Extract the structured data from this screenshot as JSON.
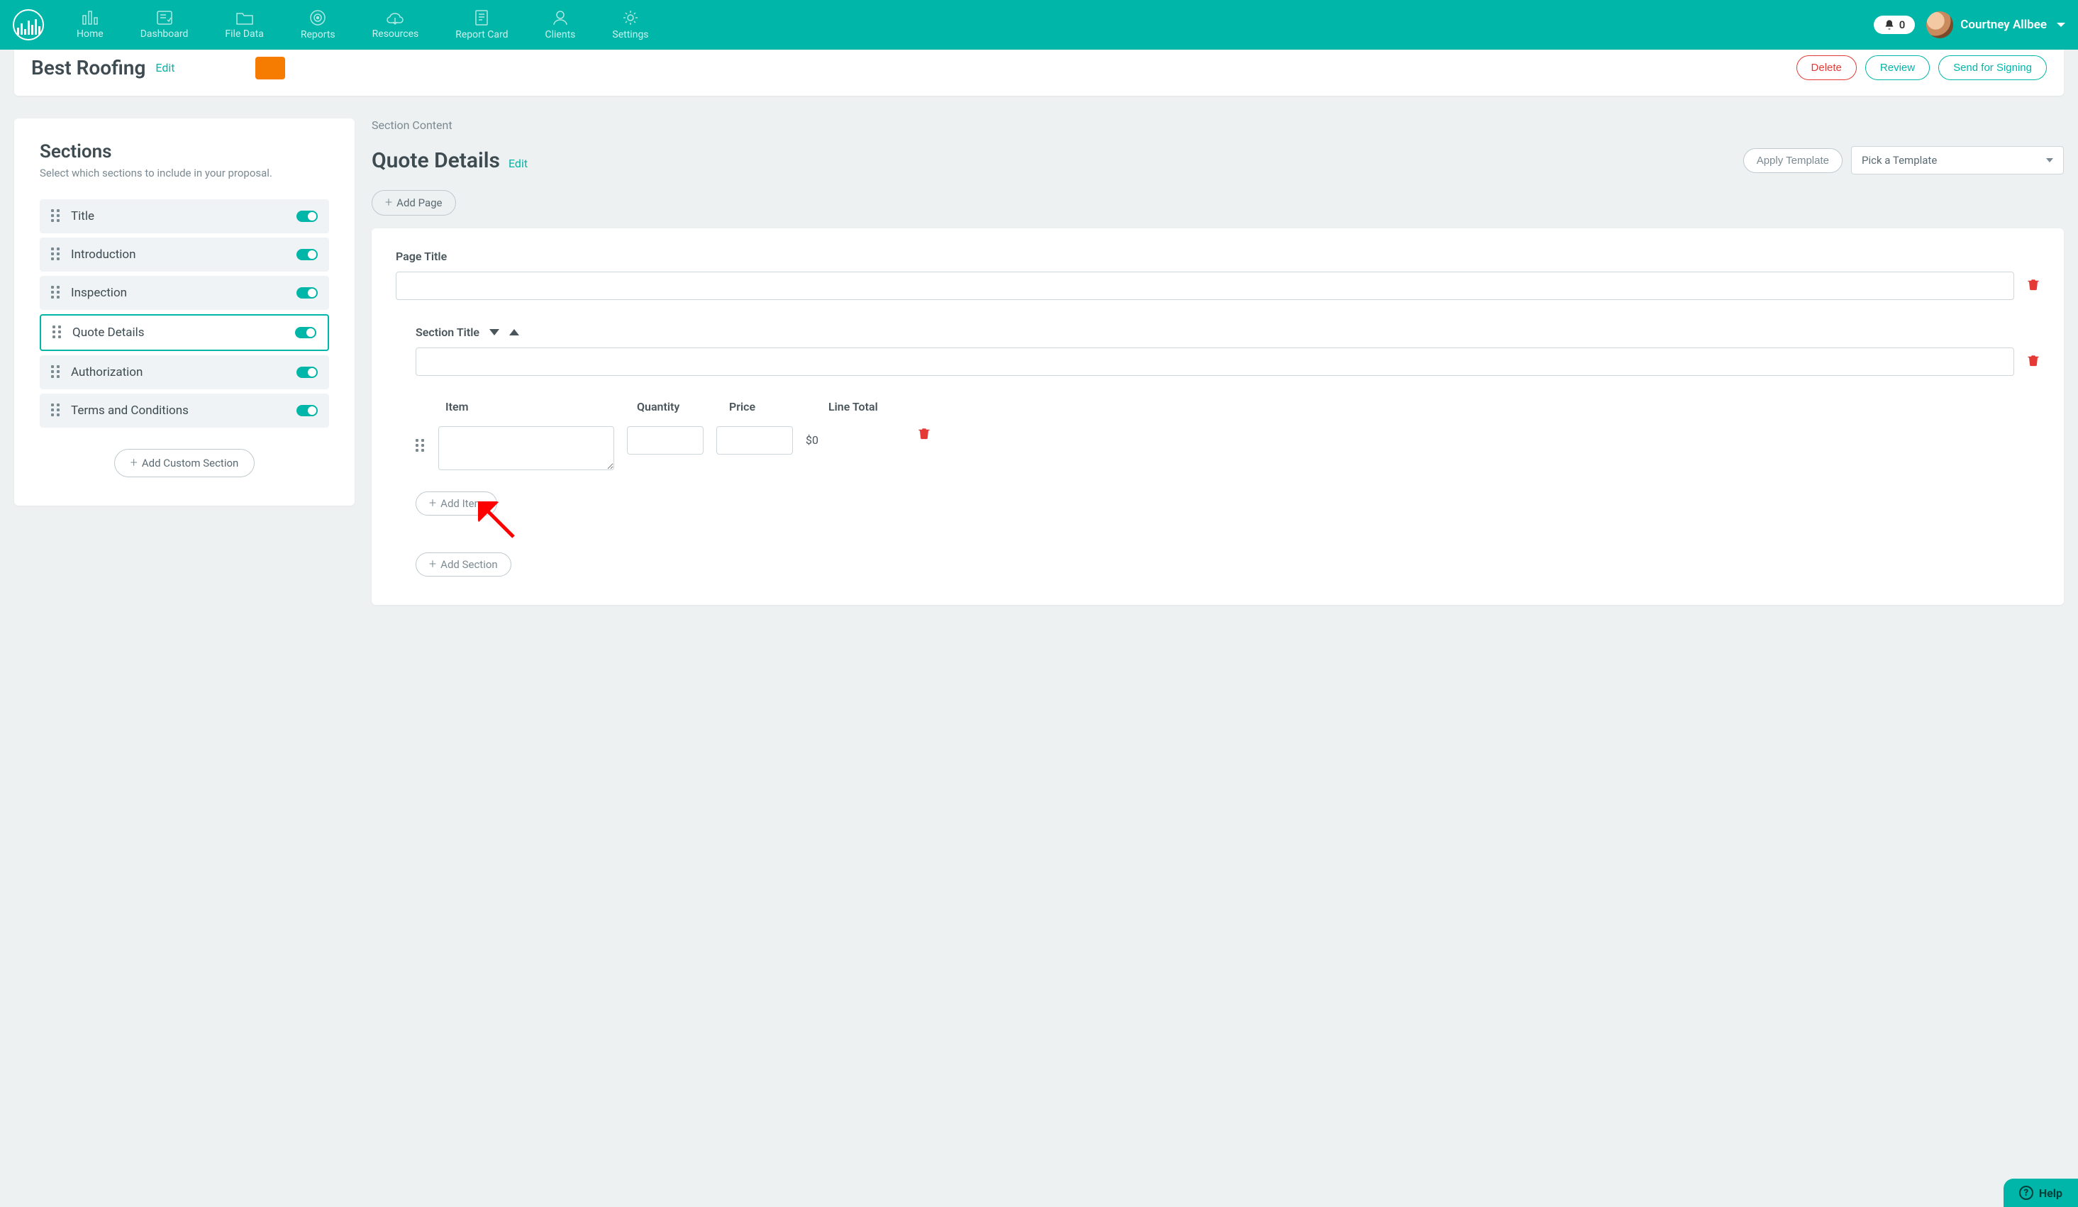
{
  "nav": {
    "items": [
      "Home",
      "Dashboard",
      "File Data",
      "Reports",
      "Resources",
      "Report Card",
      "Clients",
      "Settings"
    ],
    "notifications": "0",
    "user_name": "Courtney Allbee"
  },
  "header": {
    "title": "Best Roofing",
    "edit": "Edit",
    "actions": {
      "delete": "Delete",
      "review": "Review",
      "send": "Send for Signing"
    }
  },
  "sections_panel": {
    "heading": "Sections",
    "sub": "Select which sections to include in your proposal.",
    "items": [
      {
        "label": "Title",
        "active": false
      },
      {
        "label": "Introduction",
        "active": false
      },
      {
        "label": "Inspection",
        "active": false
      },
      {
        "label": "Quote Details",
        "active": true
      },
      {
        "label": "Authorization",
        "active": false
      },
      {
        "label": "Terms and Conditions",
        "active": false
      }
    ],
    "add_custom": "Add Custom Section"
  },
  "content": {
    "section_content_label": "Section Content",
    "title": "Quote Details",
    "edit": "Edit",
    "apply_template": "Apply Template",
    "template_placeholder": "Pick a Template",
    "add_page": "Add Page",
    "page_title_label": "Page Title",
    "page_title_value": "",
    "section_title_label": "Section Title",
    "section_title_value": "",
    "columns": {
      "item": "Item",
      "qty": "Quantity",
      "price": "Price",
      "total": "Line Total"
    },
    "row": {
      "item": "",
      "qty": "",
      "price": "",
      "total": "$0"
    },
    "add_item": "Add Item",
    "add_section": "Add Section"
  },
  "help": "Help"
}
